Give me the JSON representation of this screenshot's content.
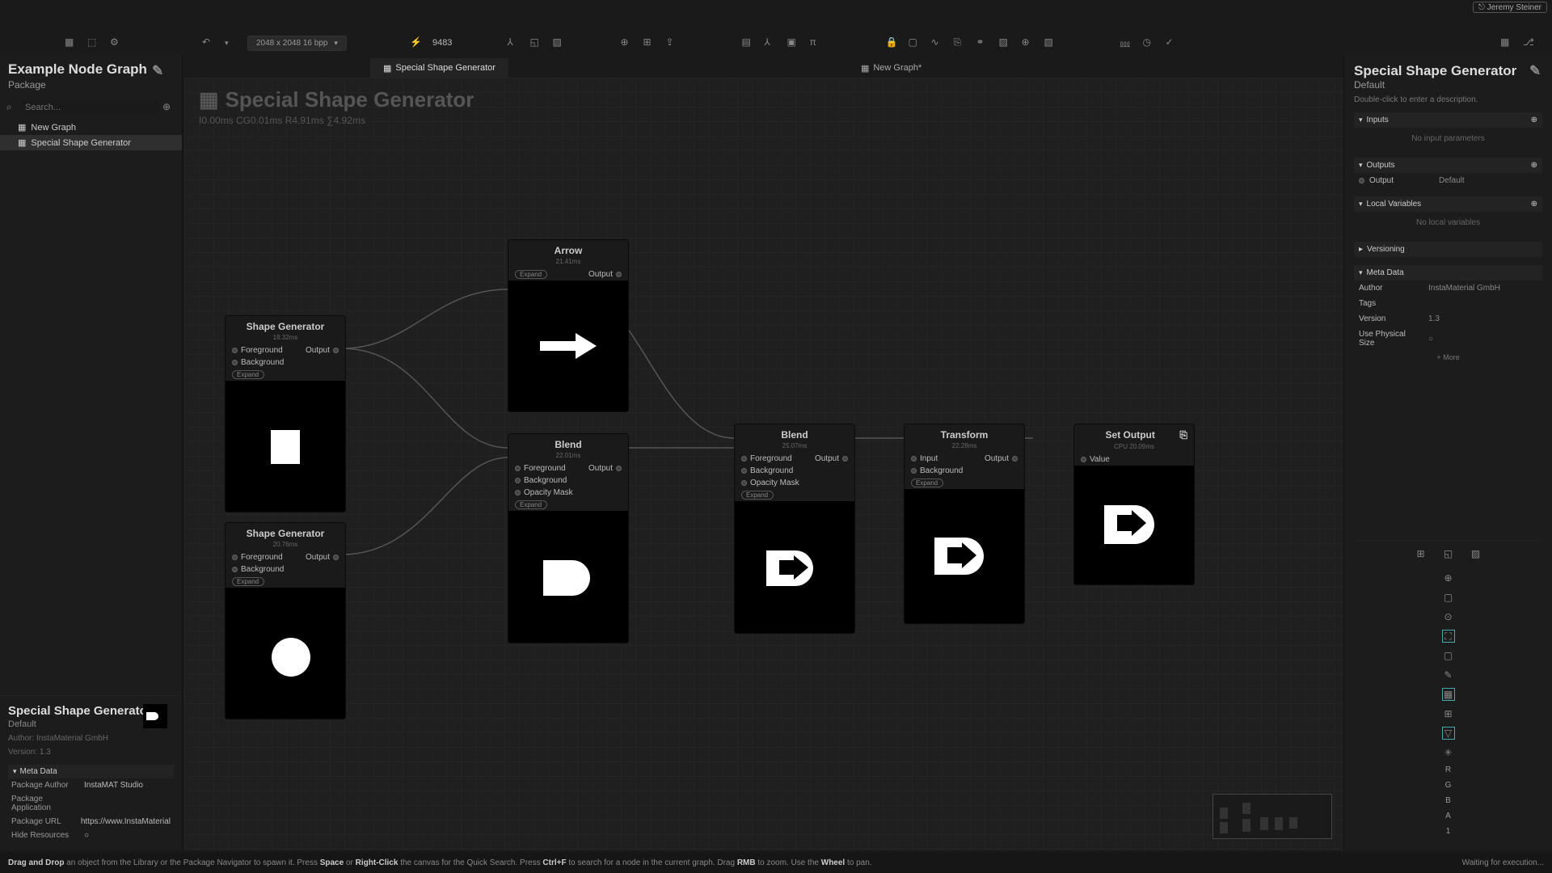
{
  "user": "Jeremy Steiner",
  "toolbar": {
    "resolution": "2048 x 2048 16 bpp",
    "fps": "9483"
  },
  "left": {
    "title": "Example Node Graph",
    "subtitle": "Package",
    "search_ph": "Search...",
    "tree": [
      "New Graph",
      "Special Shape Generator"
    ],
    "bottom": {
      "title": "Special Shape Generator",
      "sub": "Default",
      "author": "Author: InstaMaterial GmbH",
      "version": "Version: 1.3",
      "meta_head": "Meta Data",
      "rows": [
        {
          "k": "Package Author",
          "v": "InstaMAT Studio"
        },
        {
          "k": "Package Application",
          "v": ""
        },
        {
          "k": "Package URL",
          "v": "https://www.InstaMaterial"
        },
        {
          "k": "Hide Resources",
          "v": "○"
        }
      ]
    }
  },
  "tabs": [
    {
      "label": "Special Shape Generator",
      "active": true
    },
    {
      "label": "New Graph*",
      "active": false
    }
  ],
  "canvas": {
    "title": "Special Shape Generator",
    "stats": "I0.00ms CG0.01ms R4.91ms ∑4.92ms"
  },
  "nodes": {
    "sg1": {
      "title": "Shape Generator",
      "time": "19.32ms",
      "in": [
        "Foreground",
        "Background"
      ],
      "out": "Output"
    },
    "sg2": {
      "title": "Shape Generator",
      "time": "20.76ms",
      "in": [
        "Foreground",
        "Background"
      ],
      "out": "Output"
    },
    "arrow": {
      "title": "Arrow",
      "time": "21.41ms",
      "out": "Output"
    },
    "blend1": {
      "title": "Blend",
      "time": "22.01ms",
      "in": [
        "Foreground",
        "Background",
        "Opacity Mask"
      ],
      "out": "Output"
    },
    "blend2": {
      "title": "Blend",
      "time": "25.07ms",
      "in": [
        "Foreground",
        "Background",
        "Opacity Mask"
      ],
      "out": "Output"
    },
    "trans": {
      "title": "Transform",
      "time": "22.28ms",
      "in": [
        "Input",
        "Background"
      ],
      "out": "Output"
    },
    "setout": {
      "title": "Set Output",
      "time": "CPU 20.09ms",
      "in": [
        "Value"
      ]
    }
  },
  "expand": "Expand",
  "right": {
    "title": "Special Shape Generator",
    "sub": "Default",
    "desc": "Double-click to enter a description.",
    "sections": {
      "inputs": {
        "h": "Inputs",
        "empty": "No input parameters"
      },
      "outputs": {
        "h": "Outputs",
        "row": {
          "k": "Output",
          "v": "Default"
        }
      },
      "locals": {
        "h": "Local Variables",
        "empty": "No local variables"
      },
      "versioning": {
        "h": "Versioning"
      },
      "meta": {
        "h": "Meta Data",
        "rows": [
          {
            "k": "Author",
            "v": "InstaMaterial GmbH"
          },
          {
            "k": "Tags",
            "v": ""
          },
          {
            "k": "Version",
            "v": "1.3"
          },
          {
            "k": "Use Physical Size",
            "v": "○"
          }
        ],
        "more": "+ More"
      }
    },
    "channels": [
      "R",
      "G",
      "B",
      "A",
      "1"
    ]
  },
  "status": {
    "hint": "Drag and Drop an object from the Library or the Package Navigator to spawn it. Press Space or Right-Click the canvas for the Quick Search. Press Ctrl+F to search for a node in the current graph. Drag RMB to zoom. Use the Wheel to pan.",
    "right": "Waiting for execution..."
  }
}
